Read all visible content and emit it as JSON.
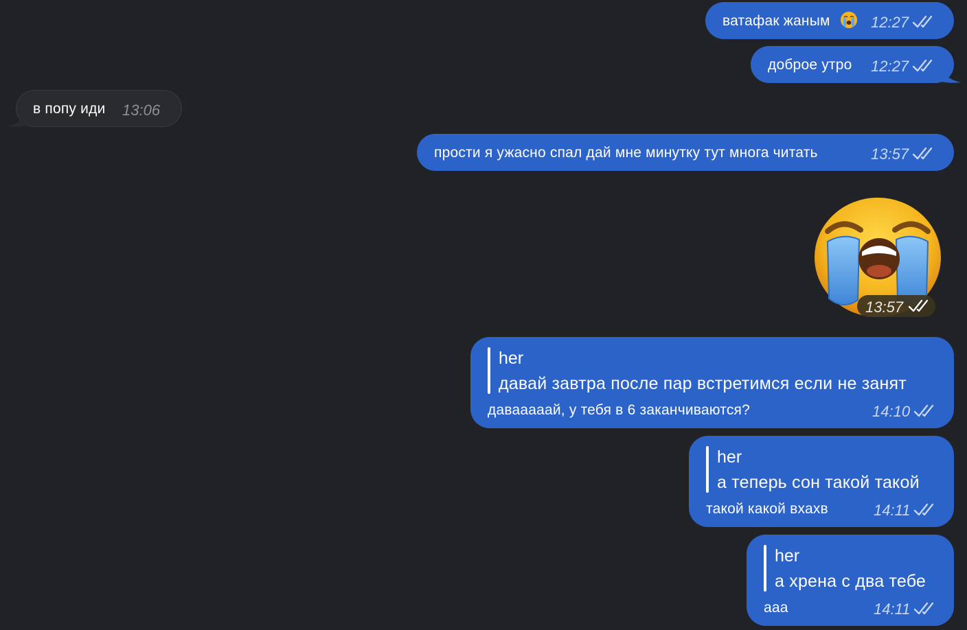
{
  "messages": [
    {
      "direction": "out",
      "text": "ватафак жаным",
      "emoji": "loudly-crying-face",
      "time": "12:27",
      "status": "read"
    },
    {
      "direction": "out",
      "text": "доброе утро",
      "time": "12:27",
      "status": "read"
    },
    {
      "direction": "in",
      "text": "в попу иди",
      "time": "13:06"
    },
    {
      "direction": "out",
      "text": "прости я ужасно спал дай мне минутку тут многа читать",
      "time": "13:57",
      "status": "read"
    },
    {
      "direction": "out",
      "type": "sticker",
      "emoji": "loudly-crying-face",
      "time": "13:57",
      "status": "read"
    },
    {
      "direction": "out",
      "reply": {
        "author": "her",
        "text": "давай завтра после пар встретимся если не занят"
      },
      "text": "давааааай, у тебя в 6 заканчиваются?",
      "time": "14:10",
      "status": "read"
    },
    {
      "direction": "out",
      "reply": {
        "author": "her",
        "text": "а теперь сон такой такой"
      },
      "text": "такой какой вхахв",
      "time": "14:11",
      "status": "read"
    },
    {
      "direction": "out",
      "reply": {
        "author": "her",
        "text": "а хрена с два тебе"
      },
      "text": "ааа",
      "time": "14:11",
      "status": "read"
    }
  ],
  "colors": {
    "background": "#212225",
    "outgoing_bubble": "#2b63c9",
    "incoming_bubble": "#2a2b2e",
    "sticker_face": "#f5b51e",
    "tears": "#5ea6ee"
  }
}
